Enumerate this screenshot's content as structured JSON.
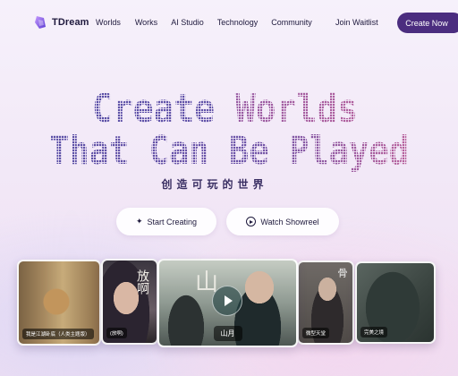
{
  "nav": {
    "brand": "TDream",
    "links": [
      "Worlds",
      "Works",
      "AI Studio",
      "Technology",
      "Community"
    ],
    "waitlist": "Join Waitlist",
    "cta": "Create Now"
  },
  "hero": {
    "line1_part1": "Create ",
    "line1_part2": "Worlds",
    "line2": "That Can Be Played",
    "subtitle": "创造可玩的世界"
  },
  "buttons": {
    "start": "Start Creating",
    "showreel": "Watch Showreel"
  },
  "cards": [
    {
      "label": "我是江湖卧底（人类主题版）",
      "title": ""
    },
    {
      "label": "(放啊)",
      "title": "放啊"
    },
    {
      "label": "山月",
      "title": "山"
    },
    {
      "label": "微型天堂",
      "title": "骨"
    },
    {
      "label": "完美之境",
      "title": ""
    }
  ],
  "colors": {
    "accent": "#4b2d7f",
    "text": "#1f1a3d",
    "gradient_purple": "#5a4fa6",
    "gradient_pink": "#b1609e"
  },
  "icons": {
    "logo": "tdream-logo-icon",
    "sparkle": "sparkle-icon",
    "play": "play-icon"
  }
}
